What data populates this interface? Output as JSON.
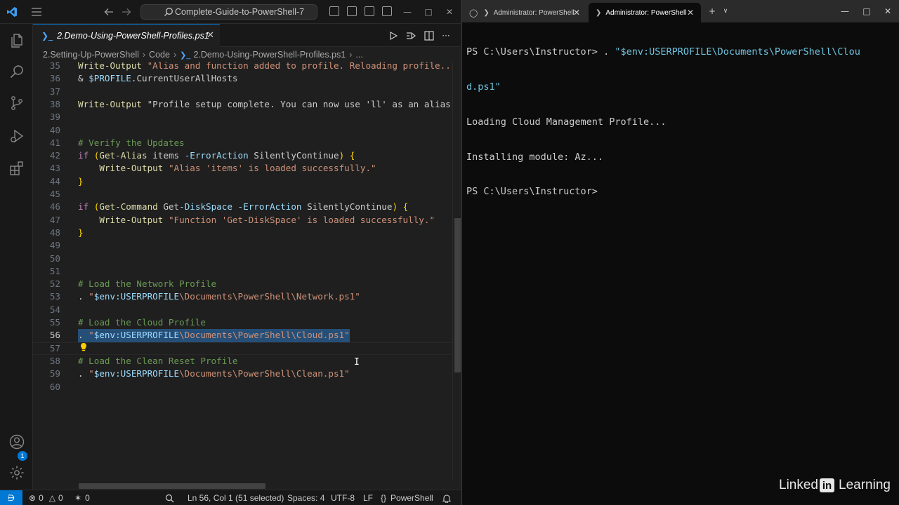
{
  "vscode": {
    "command_center": "Complete-Guide-to-PowerShell-7",
    "active_tab": "2.Demo-Using-PowerShell-Profiles.ps1",
    "breadcrumb": [
      "2.Setting-Up-PowerShell",
      "Code",
      "2.Demo-Using-PowerShell-Profiles.ps1",
      "..."
    ],
    "settings_badge": "1",
    "code_lines": [
      {
        "n": "35",
        "t": "Write-Output \"Alias and function added to profile. Reloading profile...\""
      },
      {
        "n": "36",
        "t": "& $PROFILE.CurrentUserAllHosts"
      },
      {
        "n": "37",
        "t": ""
      },
      {
        "n": "38",
        "t": "Write-Output \"Profile setup complete. You can now use 'll' as an alias for"
      },
      {
        "n": "39",
        "t": ""
      },
      {
        "n": "40",
        "t": ""
      },
      {
        "n": "41",
        "t": "# Verify the Updates"
      },
      {
        "n": "42",
        "t": "if (Get-Alias items -ErrorAction SilentlyContinue) {"
      },
      {
        "n": "43",
        "t": "    Write-Output \"Alias 'items' is loaded successfully.\""
      },
      {
        "n": "44",
        "t": "}"
      },
      {
        "n": "45",
        "t": ""
      },
      {
        "n": "46",
        "t": "if (Get-Command Get-DiskSpace -ErrorAction SilentlyContinue) {"
      },
      {
        "n": "47",
        "t": "    Write-Output \"Function 'Get-DiskSpace' is loaded successfully.\""
      },
      {
        "n": "48",
        "t": "}"
      },
      {
        "n": "49",
        "t": ""
      },
      {
        "n": "50",
        "t": ""
      },
      {
        "n": "51",
        "t": ""
      },
      {
        "n": "52",
        "t": "# Load the Network Profile"
      },
      {
        "n": "53",
        "t": ". \"$env:USERPROFILE\\Documents\\PowerShell\\Network.ps1\""
      },
      {
        "n": "54",
        "t": ""
      },
      {
        "n": "55",
        "t": "# Load the Cloud Profile"
      },
      {
        "n": "56",
        "t": ". \"$env:USERPROFILE\\Documents\\PowerShell\\Cloud.ps1\""
      },
      {
        "n": "57",
        "t": ""
      },
      {
        "n": "58",
        "t": "# Load the Clean Reset Profile"
      },
      {
        "n": "59",
        "t": ". \"$env:USERPROFILE\\Documents\\PowerShell\\Clean.ps1\""
      },
      {
        "n": "60",
        "t": ""
      }
    ],
    "statusbar": {
      "errors": "0",
      "warnings": "0",
      "ports": "0",
      "position": "Ln 56, Col 1 (51 selected)",
      "spaces": "Spaces: 4",
      "encoding": "UTF-8",
      "eol": "LF",
      "language": "PowerShell"
    },
    "colors": {
      "accent": "#0078d4",
      "selection": "#264f78"
    }
  },
  "terminal": {
    "tabs": [
      "Administrator: PowerShell",
      "Administrator: PowerShell"
    ],
    "prompt": "PS C:\\Users\\Instructor>",
    "cmd_dot": " . ",
    "cmd_string_1": "\"$env:USERPROFILE\\Documents\\PowerShell\\Clou",
    "cmd_string_2": "d.ps1\"",
    "output": [
      "Loading Cloud Management Profile...",
      "Installing module: Az..."
    ]
  },
  "watermark": {
    "linked": "Linked",
    "in": "in",
    "learning": "Learning"
  }
}
